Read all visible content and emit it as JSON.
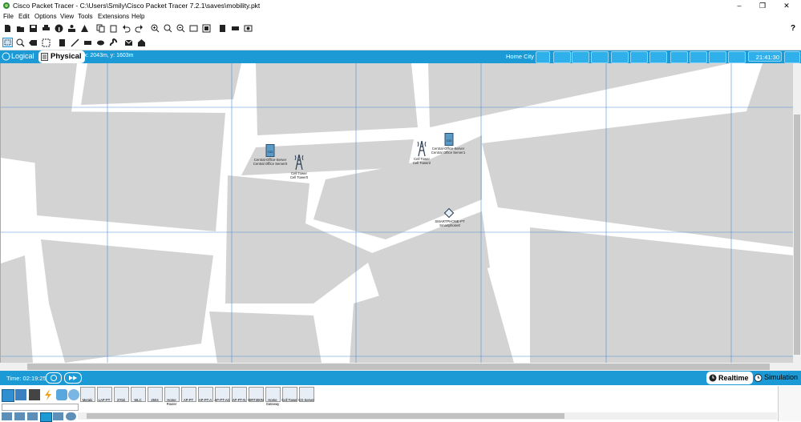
{
  "window": {
    "title": "Cisco Packet Tracer - C:\\Users\\Smily\\Cisco Packet Tracer 7.2.1\\saves\\mobility.pkt",
    "minimize": "–",
    "maximize": "❐",
    "close": "✕"
  },
  "menu": [
    "File",
    "Edit",
    "Options",
    "View",
    "Tools",
    "Extensions",
    "Help"
  ],
  "help_glyph": "?",
  "workspace_bar": {
    "logical_label": "Logical",
    "physical_label": "Physical",
    "coords": "x: 2043m, y: 1603m",
    "location": "Home City",
    "clock": "21:41:30"
  },
  "devices": [
    {
      "name": "Central-Office-Server",
      "label": "Central Office Server0",
      "icon": "server-icon"
    },
    {
      "name": "Cell Tower",
      "label": "Cell Tower0",
      "icon": "cell-tower-icon"
    },
    {
      "name": "Cell Tower",
      "label": "Cell Tower2",
      "icon": "cell-tower-icon"
    },
    {
      "name": "Central-Office-Server",
      "label": "Central Office Server1",
      "icon": "server-icon"
    },
    {
      "name": "SMARTPHONE-PT",
      "label": "Smartphone0",
      "icon": "smartphone-icon"
    }
  ],
  "status": {
    "time": "Time: 02:19:25",
    "realtime": "Realtime",
    "simulation": "Simulation"
  },
  "palette": [
    "Meraki",
    "LAP-PT",
    "3702i",
    "WLC",
    "2504",
    "Home Router",
    "AP-PT",
    "AP-PT-A",
    "AP-PT-AC",
    "AP-PT-N",
    "WRT300N",
    "Home Gateway",
    "Cell Tower",
    "CO Server"
  ],
  "colors": {
    "accent": "#1b9ad6",
    "map_block": "#d3d3d3",
    "grid": "#4a90d9"
  }
}
